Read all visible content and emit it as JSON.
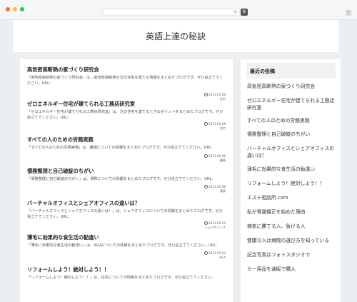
{
  "site": {
    "title": "英語上達の秘訣"
  },
  "browser": {
    "reload_glyph": "↻",
    "ext_glyph": "⚙",
    "corner_glyph": "+"
  },
  "articles": [
    {
      "title": "高気密高断熱の家づくり研究会",
      "excerpt": "「高気密高断熱の家づくり研究会」は、高気密高断熱の注文住宅を建てる情報をまとめたブログです。ぜひ役立ててください。URL:",
      "date": "2023.05.08",
      "category": "住宅"
    },
    {
      "title": "ゼロエネルギー住宅が建てられる工務店研究室",
      "excerpt": "「ゼロエネルギー住宅が建てられる工務店研究室」は、注文住宅を建てるときのポイントをまとめたブログです。ぜひ役立ててください。URL:",
      "date": "2023.05.08",
      "category": "住宅"
    },
    {
      "title": "すべての人のための労務実務",
      "excerpt": "「すべての人のための労務実務」は、離婚についての情報をまとめたブログです。ぜひ役立ててください。URL:",
      "date": "2023.05.08",
      "category": "離婚"
    },
    {
      "title": "債務整理と自己破綻のちがい",
      "excerpt": "「債務整理と自己破綻のちがい」は、債務についての情報をまとめたブログです。ぜひ役立ててください。URL:",
      "date": "2023.05.08",
      "category": "債務"
    },
    {
      "title": "バーチャルオフィスとシェアオフィスの違いは？",
      "excerpt": "「バーチャルオフィスとシェアオフィスの違いは？」は、シェアオフィスについての情報をまとめたブログです。ぜひ役立ててください。URL:",
      "date": "2023.05.04",
      "category": "シェアオフィス"
    },
    {
      "title": "薄毛に効果的な食生活の勧違い",
      "excerpt": "「薄毛に効果的な食生活の勧違い」は、AGAについての情報をまとめたブログです。ぜひ役立ててください。URL:",
      "date": "2023.05.04",
      "category": "AGA"
    },
    {
      "title": "リフォームしよう！絶対しよう！！",
      "excerpt": "「リフォームしよう！絶対しよう！！」は、住宅についての情報をまとめたブログです。ぜひ役立ててください。",
      "date": "",
      "category": ""
    }
  ],
  "sidebar": {
    "heading": "最近の投稿",
    "items": [
      "高気密高断熱の家づくり研究会",
      "ゼロエネルギー住宅が建てられる工務店研究室",
      "すべての人のための労務実務",
      "債務整理と自己破綻のちがい",
      "バーチャルオフィスとシェアオフィスの違いは？",
      "薄毛に効果的な食生活の勧違い",
      "リフォームしよう！絶対しよう！！",
      "エステ相談所.com",
      "私が骨盤矯正を始めた理由",
      "病気に勝てる人、負ける人",
      "健康な人は病院の選び方を知っている",
      "記念写真はフォトスタジオで",
      "カー用品を通販で購入"
    ]
  }
}
